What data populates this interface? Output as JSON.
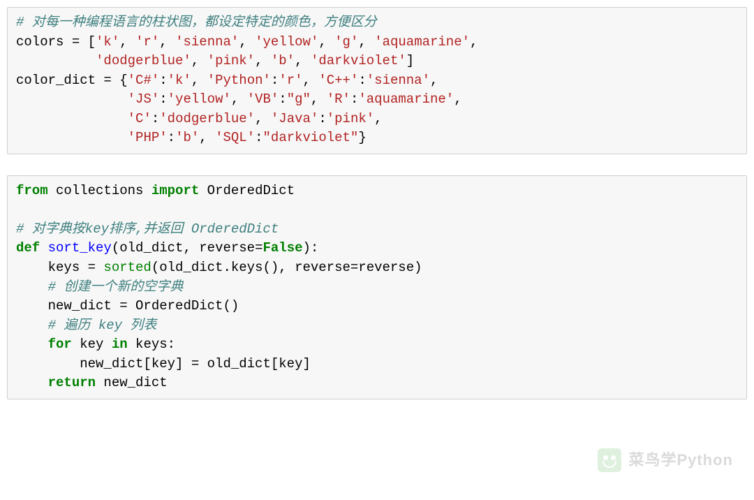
{
  "block1": {
    "c1": "# 对每一种编程语言的柱状图，都设定特定的颜色，方便区分",
    "l2a": "colors = [",
    "l2_s1": "'k'",
    "l2_s2": "'r'",
    "l2_s3": "'sienna'",
    "l2_s4": "'yellow'",
    "l2_s5": "'g'",
    "l2_s6": "'aquamarine'",
    "l3_s1": "'dodgerblue'",
    "l3_s2": "'pink'",
    "l3_s3": "'b'",
    "l3_s4": "'darkviolet'",
    "l4a": "color_dict = {",
    "d_k1": "'C#'",
    "d_v1": "'k'",
    "d_k2": "'Python'",
    "d_v2": "'r'",
    "d_k3": "'C++'",
    "d_v3": "'sienna'",
    "d_k4": "'JS'",
    "d_v4": "'yellow'",
    "d_k5": "'VB'",
    "d_v5": "\"g\"",
    "d_k6": "'R'",
    "d_v6": "'aquamarine'",
    "d_k7": "'C'",
    "d_v7": "'dodgerblue'",
    "d_k8": "'Java'",
    "d_v8": "'pink'",
    "d_k9": "'PHP'",
    "d_v9": "'b'",
    "d_k10": "'SQL'",
    "d_v10": "\"darkviolet\""
  },
  "block2": {
    "kw_from": "from",
    "mod": " collections ",
    "kw_import": "import",
    "cls": " OrderedDict",
    "c1": "# 对字典按key排序,并返回 OrderedDict",
    "kw_def": "def",
    "fn": " sort_key",
    "sig_a": "(old_dict, reverse=",
    "false": "False",
    "sig_b": "):",
    "l_keys_a": "    keys = ",
    "sorted": "sorted",
    "l_keys_b": "(old_dict.keys(), reverse=reverse)",
    "c2": "    # 创建一个新的空字典",
    "l_new": "    new_dict = OrderedDict()",
    "c3": "    # 遍历 key 列表",
    "kw_for": "for",
    "for_mid": " key ",
    "kw_in": "in",
    "for_tail": " keys:",
    "l_assign": "        new_dict[key] = old_dict[key]",
    "kw_return": "return",
    "ret_tail": " new_dict"
  },
  "watermark": "菜鸟学Python"
}
